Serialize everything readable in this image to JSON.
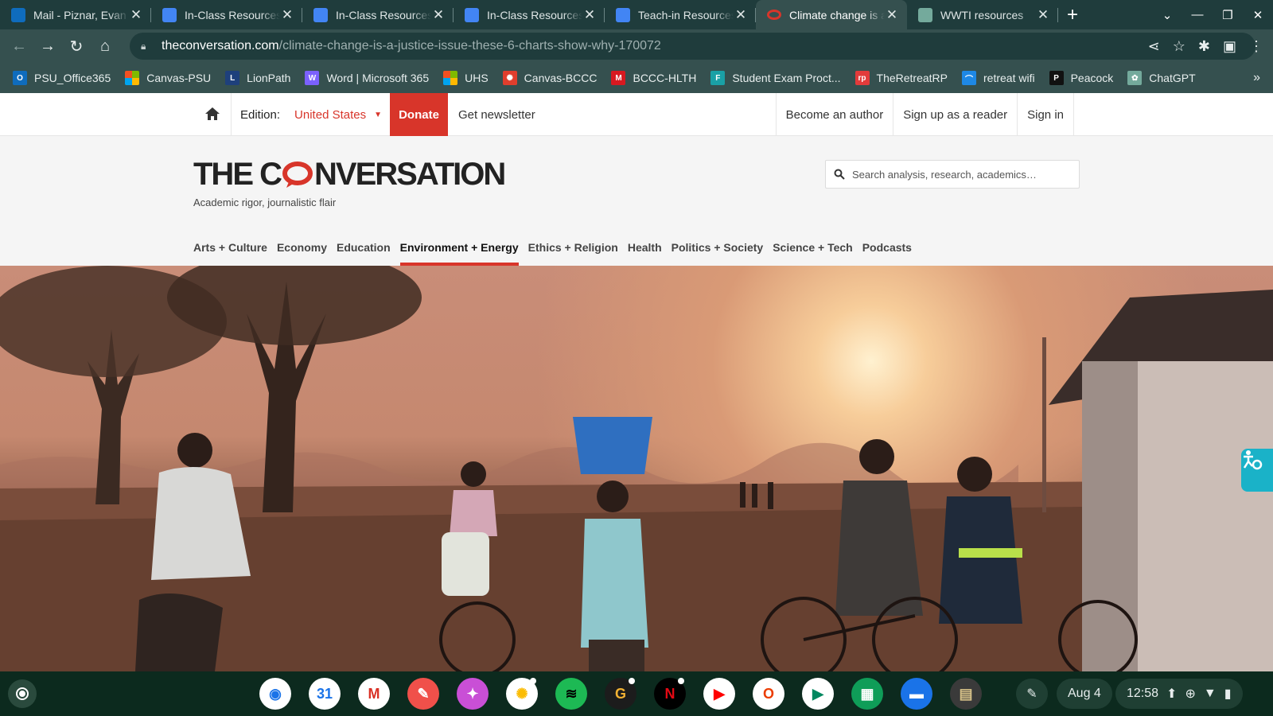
{
  "browser": {
    "tabs": [
      {
        "title": "Mail - Piznar, Evan R",
        "icon": "outlook-icon",
        "color": "#0f6cbd",
        "active": false
      },
      {
        "title": "In-Class Resources",
        "icon": "docs-icon",
        "color": "#4285f4",
        "active": false
      },
      {
        "title": "In-Class Resources",
        "icon": "docs-icon",
        "color": "#4285f4",
        "active": false
      },
      {
        "title": "In-Class Resources",
        "icon": "docs-icon",
        "color": "#4285f4",
        "active": false
      },
      {
        "title": "Teach-in Resources",
        "icon": "docs-icon",
        "color": "#4285f4",
        "active": false
      },
      {
        "title": "Climate change is a",
        "icon": "conversation-icon",
        "color": "#d8352a",
        "active": true
      },
      {
        "title": "WWTI resources",
        "icon": "chatgpt-icon",
        "color": "#74aa9c",
        "active": false
      }
    ],
    "url_host": "theconversation.com",
    "url_path": "/climate-change-is-a-justice-issue-these-6-charts-show-why-170072",
    "bookmarks": [
      {
        "label": "PSU_Office365",
        "icon": "office-icon",
        "color": "#0f6cbd",
        "glyph": "O"
      },
      {
        "label": "Canvas-PSU",
        "icon": "microsoft-icon",
        "color": "#f25022",
        "glyph": ""
      },
      {
        "label": "LionPath",
        "icon": "lionpath-icon",
        "color": "#1e407c",
        "glyph": "L"
      },
      {
        "label": "Word | Microsoft 365",
        "icon": "m365-icon",
        "color": "#7b61ff",
        "glyph": "W"
      },
      {
        "label": "UHS",
        "icon": "microsoft-icon",
        "color": "#f25022",
        "glyph": ""
      },
      {
        "label": "Canvas-BCCC",
        "icon": "canvas-icon",
        "color": "#e03e2d",
        "glyph": "✺"
      },
      {
        "label": "BCCC-HLTH",
        "icon": "mcgraw-icon",
        "color": "#d71920",
        "glyph": "M"
      },
      {
        "label": "Student Exam Proct...",
        "icon": "exam-icon",
        "color": "#1aa0a6",
        "glyph": "F"
      },
      {
        "label": "TheRetreatRP",
        "icon": "retreat-icon",
        "color": "#e23b3b",
        "glyph": "rp"
      },
      {
        "label": "retreat wifi",
        "icon": "wifi-bookmark-icon",
        "color": "#1e88e5",
        "glyph": "⌒"
      },
      {
        "label": "Peacock",
        "icon": "peacock-icon",
        "color": "#111111",
        "glyph": "P"
      },
      {
        "label": "ChatGPT",
        "icon": "chatgpt-icon",
        "color": "#74aa9c",
        "glyph": "✿"
      }
    ]
  },
  "site": {
    "edition_label": "Edition:",
    "edition_value": "United States",
    "donate": "Donate",
    "newsletter": "Get newsletter",
    "right_links": [
      "Become an author",
      "Sign up as a reader",
      "Sign in"
    ],
    "logo_left": "THE C",
    "logo_right": "NVERSATION",
    "tagline": "Academic rigor, journalistic flair",
    "search_placeholder": "Search analysis, research, academics…",
    "sections": [
      {
        "label": "Arts + Culture",
        "active": false
      },
      {
        "label": "Economy",
        "active": false
      },
      {
        "label": "Education",
        "active": false
      },
      {
        "label": "Environment + Energy",
        "active": true
      },
      {
        "label": "Ethics + Religion",
        "active": false
      },
      {
        "label": "Health",
        "active": false
      },
      {
        "label": "Politics + Society",
        "active": false
      },
      {
        "label": "Science + Tech",
        "active": false
      },
      {
        "label": "Podcasts",
        "active": false
      }
    ],
    "accent_color": "#d8352a"
  },
  "shelf": {
    "apps": [
      {
        "name": "chrome-app-icon",
        "bg": "#ffffff",
        "glyph": "◉",
        "fg": "#1a73e8",
        "dot": false
      },
      {
        "name": "calendar-app-icon",
        "bg": "#ffffff",
        "glyph": "31",
        "fg": "#1a73e8",
        "dot": false
      },
      {
        "name": "gmail-app-icon",
        "bg": "#ffffff",
        "glyph": "M",
        "fg": "#d93025",
        "dot": false
      },
      {
        "name": "canvas-paint-app-icon",
        "bg": "#f0504a",
        "glyph": "✎",
        "fg": "#ffffff",
        "dot": false
      },
      {
        "name": "gallery-app-icon",
        "bg": "#c94fd6",
        "glyph": "✦",
        "fg": "#ffffff",
        "dot": false
      },
      {
        "name": "photos-app-icon",
        "bg": "#ffffff",
        "glyph": "✺",
        "fg": "#fbbc04",
        "dot": true
      },
      {
        "name": "spotify-app-icon",
        "bg": "#1db954",
        "glyph": "≋",
        "fg": "#000000",
        "dot": false
      },
      {
        "name": "grammarly-app-icon",
        "bg": "#1c1c1c",
        "glyph": "G",
        "fg": "#f2b233",
        "dot": true
      },
      {
        "name": "netflix-app-icon",
        "bg": "#000000",
        "glyph": "N",
        "fg": "#e50914",
        "dot": true
      },
      {
        "name": "youtube-app-icon",
        "bg": "#ffffff",
        "glyph": "▶",
        "fg": "#ff0000",
        "dot": false
      },
      {
        "name": "office-app-icon",
        "bg": "#ffffff",
        "glyph": "O",
        "fg": "#eb3c00",
        "dot": false
      },
      {
        "name": "play-store-app-icon",
        "bg": "#ffffff",
        "glyph": "▶",
        "fg": "#01875f",
        "dot": false
      },
      {
        "name": "sheets-app-icon",
        "bg": "#0f9d58",
        "glyph": "▦",
        "fg": "#ffffff",
        "dot": false
      },
      {
        "name": "files-app-icon",
        "bg": "#1a73e8",
        "glyph": "▬",
        "fg": "#ffffff",
        "dot": false
      },
      {
        "name": "avatar-app-icon",
        "bg": "#3a3a3a",
        "glyph": "▤",
        "fg": "#d9c38a",
        "dot": false
      }
    ],
    "date": "Aug 4",
    "time": "12:58"
  }
}
